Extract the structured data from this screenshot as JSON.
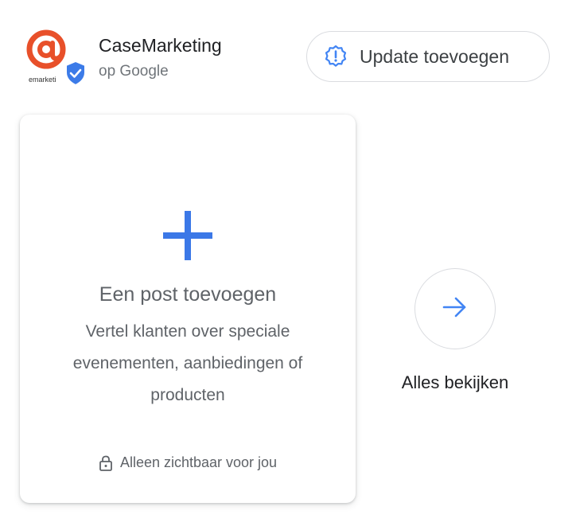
{
  "header": {
    "logo_text": "emarketi",
    "business_name": "CaseMarketing",
    "subtitle": "op Google",
    "update_button_label": "Update toevoegen",
    "update_icon": "alert-badge-icon",
    "verified_icon": "verified-shield-icon"
  },
  "card": {
    "add_icon": "plus-icon",
    "title": "Een post toevoegen",
    "description": "Vertel klanten over speciale evenementen, aanbiedingen of producten",
    "lock_icon": "lock-icon",
    "footer_text": "Alleen zichtbaar voor jou"
  },
  "see_all": {
    "arrow_icon": "arrow-right-icon",
    "label": "Alles bekijken"
  },
  "colors": {
    "accent_blue": "#4285f4",
    "logo_orange": "#e8502a",
    "text_primary": "#202124",
    "text_secondary": "#5f6368",
    "border": "#dadce0"
  }
}
